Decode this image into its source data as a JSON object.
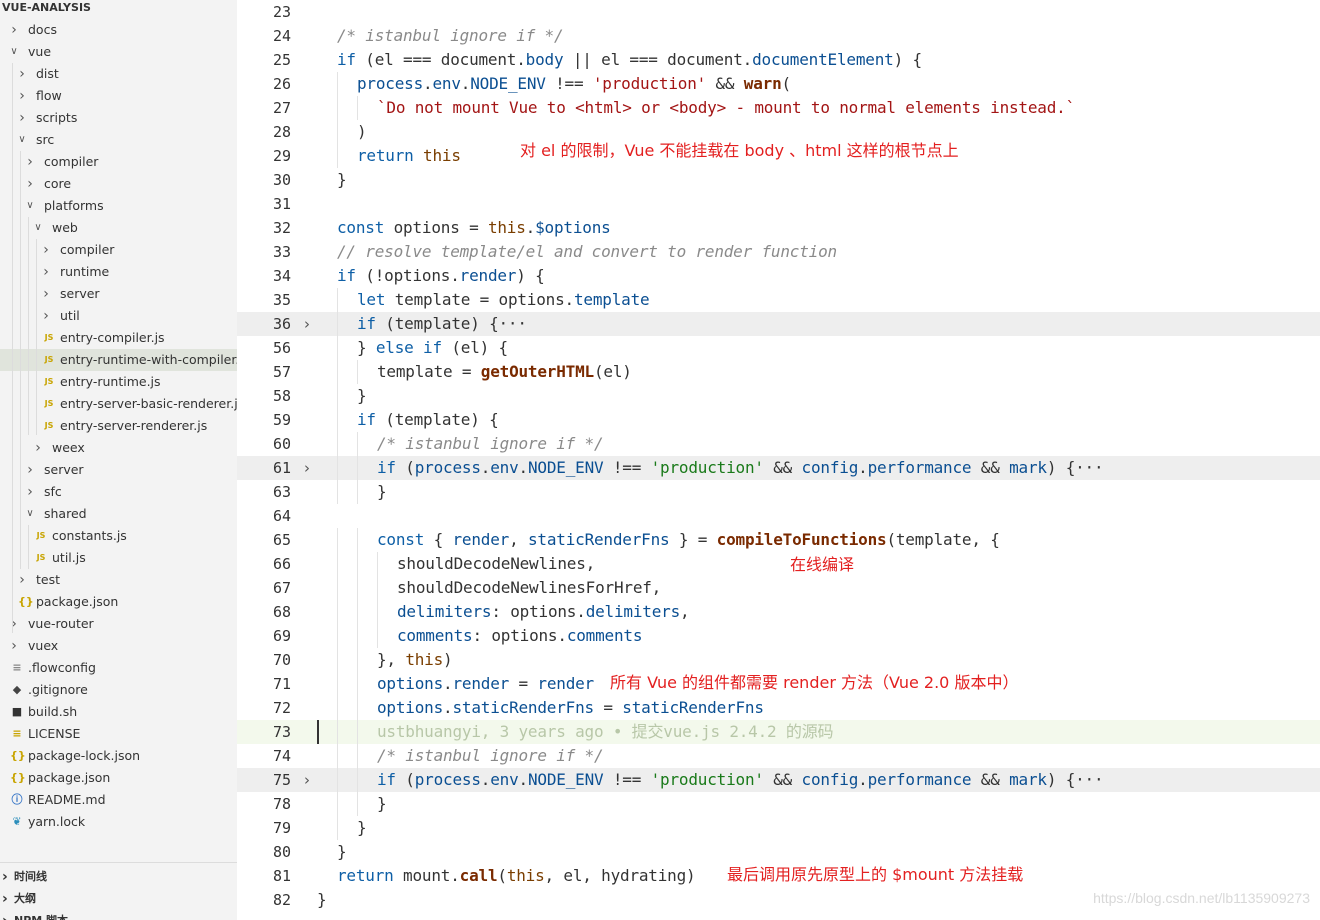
{
  "sidebar": {
    "header": "VUE-ANALYSIS",
    "items": [
      {
        "label": "docs",
        "kind": "folder",
        "open": false,
        "depth": 0
      },
      {
        "label": "vue",
        "kind": "folder",
        "open": true,
        "depth": 0
      },
      {
        "label": "dist",
        "kind": "folder",
        "open": false,
        "depth": 1
      },
      {
        "label": "flow",
        "kind": "folder",
        "open": false,
        "depth": 1
      },
      {
        "label": "scripts",
        "kind": "folder",
        "open": false,
        "depth": 1
      },
      {
        "label": "src",
        "kind": "folder",
        "open": true,
        "depth": 1
      },
      {
        "label": "compiler",
        "kind": "folder",
        "open": false,
        "depth": 2
      },
      {
        "label": "core",
        "kind": "folder",
        "open": false,
        "depth": 2
      },
      {
        "label": "platforms",
        "kind": "folder",
        "open": true,
        "depth": 2
      },
      {
        "label": "web",
        "kind": "folder",
        "open": true,
        "depth": 3
      },
      {
        "label": "compiler",
        "kind": "folder",
        "open": false,
        "depth": 4
      },
      {
        "label": "runtime",
        "kind": "folder",
        "open": false,
        "depth": 4
      },
      {
        "label": "server",
        "kind": "folder",
        "open": false,
        "depth": 4
      },
      {
        "label": "util",
        "kind": "folder",
        "open": false,
        "depth": 4
      },
      {
        "label": "entry-compiler.js",
        "kind": "js",
        "depth": 4
      },
      {
        "label": "entry-runtime-with-compiler.js",
        "kind": "js",
        "depth": 4,
        "selected": true
      },
      {
        "label": "entry-runtime.js",
        "kind": "js",
        "depth": 4
      },
      {
        "label": "entry-server-basic-renderer.js",
        "kind": "js",
        "depth": 4
      },
      {
        "label": "entry-server-renderer.js",
        "kind": "js",
        "depth": 4
      },
      {
        "label": "weex",
        "kind": "folder",
        "open": false,
        "depth": 3
      },
      {
        "label": "server",
        "kind": "folder",
        "open": false,
        "depth": 2
      },
      {
        "label": "sfc",
        "kind": "folder",
        "open": false,
        "depth": 2
      },
      {
        "label": "shared",
        "kind": "folder",
        "open": true,
        "depth": 2
      },
      {
        "label": "constants.js",
        "kind": "js",
        "depth": 3
      },
      {
        "label": "util.js",
        "kind": "js",
        "depth": 3
      },
      {
        "label": "test",
        "kind": "folder",
        "open": false,
        "depth": 1
      },
      {
        "label": "package.json",
        "kind": "json",
        "depth": 1
      },
      {
        "label": "vue-router",
        "kind": "folder",
        "open": false,
        "depth": 0
      },
      {
        "label": "vuex",
        "kind": "folder",
        "open": false,
        "depth": 0
      },
      {
        "label": ".flowconfig",
        "kind": "config",
        "depth": 0
      },
      {
        "label": ".gitignore",
        "kind": "git",
        "depth": 0
      },
      {
        "label": "build.sh",
        "kind": "shell",
        "depth": 0
      },
      {
        "label": "LICENSE",
        "kind": "license",
        "depth": 0
      },
      {
        "label": "package-lock.json",
        "kind": "json",
        "depth": 0
      },
      {
        "label": "package.json",
        "kind": "json",
        "depth": 0
      },
      {
        "label": "README.md",
        "kind": "info",
        "depth": 0
      },
      {
        "label": "yarn.lock",
        "kind": "yarn",
        "depth": 0
      }
    ],
    "sections": [
      "时间线",
      "大纲",
      "NPM 脚本"
    ]
  },
  "editor": {
    "lines": [
      {
        "n": "23",
        "indent": 0,
        "tokens": []
      },
      {
        "n": "24",
        "indent": 1,
        "tokens": [
          {
            "t": "/* istanbul ignore if */",
            "c": "com"
          }
        ]
      },
      {
        "n": "25",
        "indent": 1,
        "tokens": [
          {
            "t": "if",
            "c": "kw"
          },
          {
            "t": " (el === document.",
            "c": "plain"
          },
          {
            "t": "body",
            "c": "prop"
          },
          {
            "t": " || el === document.",
            "c": "plain"
          },
          {
            "t": "documentElement",
            "c": "prop"
          },
          {
            "t": ") {",
            "c": "plain"
          }
        ]
      },
      {
        "n": "26",
        "indent": 2,
        "tokens": [
          {
            "t": "process",
            "c": "prop"
          },
          {
            "t": ".",
            "c": "plain"
          },
          {
            "t": "env",
            "c": "prop"
          },
          {
            "t": ".",
            "c": "plain"
          },
          {
            "t": "NODE_ENV",
            "c": "prop"
          },
          {
            "t": " !== ",
            "c": "plain"
          },
          {
            "t": "'production'",
            "c": "str"
          },
          {
            "t": " && ",
            "c": "plain"
          },
          {
            "t": "warn",
            "c": "fn"
          },
          {
            "t": "(",
            "c": "plain"
          }
        ]
      },
      {
        "n": "27",
        "indent": 3,
        "tokens": [
          {
            "t": "`Do not mount Vue to <html> or <body> - mount to normal elements instead.`",
            "c": "str"
          }
        ]
      },
      {
        "n": "28",
        "indent": 2,
        "tokens": [
          {
            "t": ")",
            "c": "plain"
          }
        ]
      },
      {
        "n": "29",
        "indent": 2,
        "tokens": [
          {
            "t": "return",
            "c": "kw"
          },
          {
            "t": " ",
            "c": "plain"
          },
          {
            "t": "this",
            "c": "this"
          }
        ]
      },
      {
        "n": "30",
        "indent": 1,
        "tokens": [
          {
            "t": "}",
            "c": "plain"
          }
        ]
      },
      {
        "n": "31",
        "indent": 0,
        "tokens": []
      },
      {
        "n": "32",
        "indent": 1,
        "tokens": [
          {
            "t": "const",
            "c": "kw"
          },
          {
            "t": " options = ",
            "c": "plain"
          },
          {
            "t": "this",
            "c": "this"
          },
          {
            "t": ".",
            "c": "plain"
          },
          {
            "t": "$options",
            "c": "prop"
          }
        ]
      },
      {
        "n": "33",
        "indent": 1,
        "tokens": [
          {
            "t": "// resolve template/el and convert to render function",
            "c": "com"
          }
        ]
      },
      {
        "n": "34",
        "indent": 1,
        "tokens": [
          {
            "t": "if",
            "c": "kw"
          },
          {
            "t": " (!options.",
            "c": "plain"
          },
          {
            "t": "render",
            "c": "prop"
          },
          {
            "t": ") {",
            "c": "plain"
          }
        ]
      },
      {
        "n": "35",
        "indent": 2,
        "tokens": [
          {
            "t": "let",
            "c": "kw"
          },
          {
            "t": " template = options.",
            "c": "plain"
          },
          {
            "t": "template",
            "c": "prop"
          }
        ]
      },
      {
        "n": "36",
        "indent": 2,
        "fold": true,
        "hl": true,
        "tokens": [
          {
            "t": "if",
            "c": "kw"
          },
          {
            "t": " (template) {···",
            "c": "plain"
          }
        ]
      },
      {
        "n": "56",
        "indent": 2,
        "tokens": [
          {
            "t": "} ",
            "c": "plain"
          },
          {
            "t": "else if",
            "c": "kw"
          },
          {
            "t": " (el) {",
            "c": "plain"
          }
        ]
      },
      {
        "n": "57",
        "indent": 3,
        "tokens": [
          {
            "t": "template = ",
            "c": "plain"
          },
          {
            "t": "getOuterHTML",
            "c": "fn"
          },
          {
            "t": "(el)",
            "c": "plain"
          }
        ]
      },
      {
        "n": "58",
        "indent": 2,
        "tokens": [
          {
            "t": "}",
            "c": "plain"
          }
        ]
      },
      {
        "n": "59",
        "indent": 2,
        "tokens": [
          {
            "t": "if",
            "c": "kw"
          },
          {
            "t": " (template) {",
            "c": "plain"
          }
        ]
      },
      {
        "n": "60",
        "indent": 3,
        "tokens": [
          {
            "t": "/* istanbul ignore if */",
            "c": "com"
          }
        ]
      },
      {
        "n": "61",
        "indent": 3,
        "fold": true,
        "hl": true,
        "tokens": [
          {
            "t": "if",
            "c": "kw"
          },
          {
            "t": " (",
            "c": "plain"
          },
          {
            "t": "process",
            "c": "prop"
          },
          {
            "t": ".",
            "c": "plain"
          },
          {
            "t": "env",
            "c": "prop"
          },
          {
            "t": ".",
            "c": "plain"
          },
          {
            "t": "NODE_ENV",
            "c": "prop"
          },
          {
            "t": " !== ",
            "c": "plain"
          },
          {
            "t": "'production'",
            "c": "str2"
          },
          {
            "t": " && ",
            "c": "plain"
          },
          {
            "t": "config",
            "c": "prop"
          },
          {
            "t": ".",
            "c": "plain"
          },
          {
            "t": "performance",
            "c": "prop"
          },
          {
            "t": " && ",
            "c": "plain"
          },
          {
            "t": "mark",
            "c": "prop"
          },
          {
            "t": ") {···",
            "c": "plain"
          }
        ]
      },
      {
        "n": "63",
        "indent": 3,
        "tokens": [
          {
            "t": "}",
            "c": "plain"
          }
        ]
      },
      {
        "n": "64",
        "indent": 0,
        "tokens": []
      },
      {
        "n": "65",
        "indent": 3,
        "tokens": [
          {
            "t": "const",
            "c": "kw"
          },
          {
            "t": " { ",
            "c": "plain"
          },
          {
            "t": "render",
            "c": "prop"
          },
          {
            "t": ", ",
            "c": "plain"
          },
          {
            "t": "staticRenderFns",
            "c": "prop"
          },
          {
            "t": " } = ",
            "c": "plain"
          },
          {
            "t": "compileToFunctions",
            "c": "fn"
          },
          {
            "t": "(template, {",
            "c": "plain"
          }
        ]
      },
      {
        "n": "66",
        "indent": 4,
        "tokens": [
          {
            "t": "shouldDecodeNewlines,",
            "c": "plain"
          }
        ]
      },
      {
        "n": "67",
        "indent": 4,
        "tokens": [
          {
            "t": "shouldDecodeNewlinesForHref,",
            "c": "plain"
          }
        ]
      },
      {
        "n": "68",
        "indent": 4,
        "tokens": [
          {
            "t": "delimiters",
            "c": "prop"
          },
          {
            "t": ": options.",
            "c": "plain"
          },
          {
            "t": "delimiters",
            "c": "prop"
          },
          {
            "t": ",",
            "c": "plain"
          }
        ]
      },
      {
        "n": "69",
        "indent": 4,
        "tokens": [
          {
            "t": "comments",
            "c": "prop"
          },
          {
            "t": ": options.",
            "c": "plain"
          },
          {
            "t": "comments",
            "c": "prop"
          }
        ]
      },
      {
        "n": "70",
        "indent": 3,
        "tokens": [
          {
            "t": "}, ",
            "c": "plain"
          },
          {
            "t": "this",
            "c": "this"
          },
          {
            "t": ")",
            "c": "plain"
          }
        ]
      },
      {
        "n": "71",
        "indent": 3,
        "tokens": [
          {
            "t": "options",
            "c": "prop"
          },
          {
            "t": ".",
            "c": "plain"
          },
          {
            "t": "render",
            "c": "prop"
          },
          {
            "t": " = ",
            "c": "plain"
          },
          {
            "t": "render",
            "c": "prop"
          }
        ]
      },
      {
        "n": "72",
        "indent": 3,
        "tokens": [
          {
            "t": "options",
            "c": "prop"
          },
          {
            "t": ".",
            "c": "plain"
          },
          {
            "t": "staticRenderFns",
            "c": "prop"
          },
          {
            "t": " = ",
            "c": "plain"
          },
          {
            "t": "staticRenderFns",
            "c": "prop"
          }
        ]
      },
      {
        "n": "73",
        "indent": 3,
        "cur": true,
        "tokens": [
          {
            "t": "ustbhuangyi, 3 years ago • 提交vue.js 2.4.2 的源码",
            "c": "blame"
          }
        ]
      },
      {
        "n": "74",
        "indent": 3,
        "tokens": [
          {
            "t": "/* istanbul ignore if */",
            "c": "com"
          }
        ]
      },
      {
        "n": "75",
        "indent": 3,
        "fold": true,
        "hl": true,
        "tokens": [
          {
            "t": "if",
            "c": "kw"
          },
          {
            "t": " (",
            "c": "plain"
          },
          {
            "t": "process",
            "c": "prop"
          },
          {
            "t": ".",
            "c": "plain"
          },
          {
            "t": "env",
            "c": "prop"
          },
          {
            "t": ".",
            "c": "plain"
          },
          {
            "t": "NODE_ENV",
            "c": "prop"
          },
          {
            "t": " !== ",
            "c": "plain"
          },
          {
            "t": "'production'",
            "c": "str2"
          },
          {
            "t": " && ",
            "c": "plain"
          },
          {
            "t": "config",
            "c": "prop"
          },
          {
            "t": ".",
            "c": "plain"
          },
          {
            "t": "performance",
            "c": "prop"
          },
          {
            "t": " && ",
            "c": "plain"
          },
          {
            "t": "mark",
            "c": "prop"
          },
          {
            "t": ") {···",
            "c": "plain"
          }
        ]
      },
      {
        "n": "78",
        "indent": 3,
        "tokens": [
          {
            "t": "}",
            "c": "plain"
          }
        ]
      },
      {
        "n": "79",
        "indent": 2,
        "tokens": [
          {
            "t": "}",
            "c": "plain"
          }
        ]
      },
      {
        "n": "80",
        "indent": 1,
        "tokens": [
          {
            "t": "}",
            "c": "plain"
          }
        ]
      },
      {
        "n": "81",
        "indent": 1,
        "tokens": [
          {
            "t": "return",
            "c": "kw"
          },
          {
            "t": " mount.",
            "c": "plain"
          },
          {
            "t": "call",
            "c": "fn"
          },
          {
            "t": "(",
            "c": "plain"
          },
          {
            "t": "this",
            "c": "this"
          },
          {
            "t": ", el, hydrating)",
            "c": "plain"
          }
        ]
      },
      {
        "n": "82",
        "indent": 0,
        "tokens": [
          {
            "t": "}",
            "c": "plain"
          }
        ]
      }
    ],
    "annotations": {
      "line29": "对 el 的限制，Vue 不能挂载在 body 、html 这样的根节点上",
      "line66": "在线编译",
      "line71": "所有 Vue 的组件都需要 render 方法（Vue 2.0 版本中）",
      "line81": "最后调用原先原型上的 $mount 方法挂载"
    },
    "watermark": "https://blog.csdn.net/lb1135909273"
  },
  "colors": {
    "annotation": "#e32020",
    "keyword": "#0e5fa6",
    "string": "#a31515",
    "comment": "#8a8a8a",
    "selected_file": "#e0e4dc",
    "current_line": "#f3f9ec"
  }
}
